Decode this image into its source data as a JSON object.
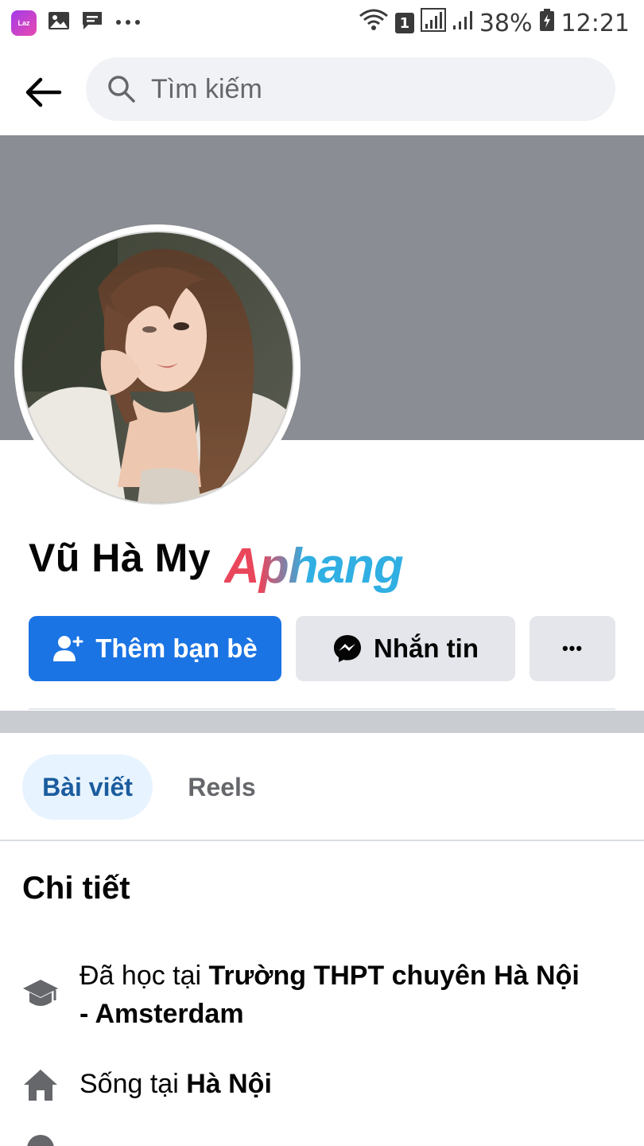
{
  "status_bar": {
    "app_icon_text": "Laz",
    "sim_slot": "1",
    "battery": "38%",
    "time": "12:21"
  },
  "search": {
    "placeholder": "Tìm kiếm"
  },
  "profile": {
    "name": "Vũ Hà My",
    "watermark": "Aphang"
  },
  "actions": {
    "add_friend": "Thêm bạn bè",
    "message": "Nhắn tin",
    "more": "•••"
  },
  "tabs": [
    {
      "label": "Bài viết",
      "active": true
    },
    {
      "label": "Reels",
      "active": false
    }
  ],
  "details": {
    "title": "Chi tiết",
    "education": {
      "prefix": "Đã học tại ",
      "value": "Trường THPT chuyên Hà Nội - Amsterdam"
    },
    "lives_in": {
      "prefix": "Sống tại ",
      "value": "Hà Nội"
    }
  },
  "colors": {
    "primary_blue": "#1b74e4",
    "secondary_button": "#e4e6eb",
    "cover_gray": "#8a8d93",
    "active_tab_bg": "#e7f3ff",
    "active_tab_text": "#1b5c9e"
  }
}
